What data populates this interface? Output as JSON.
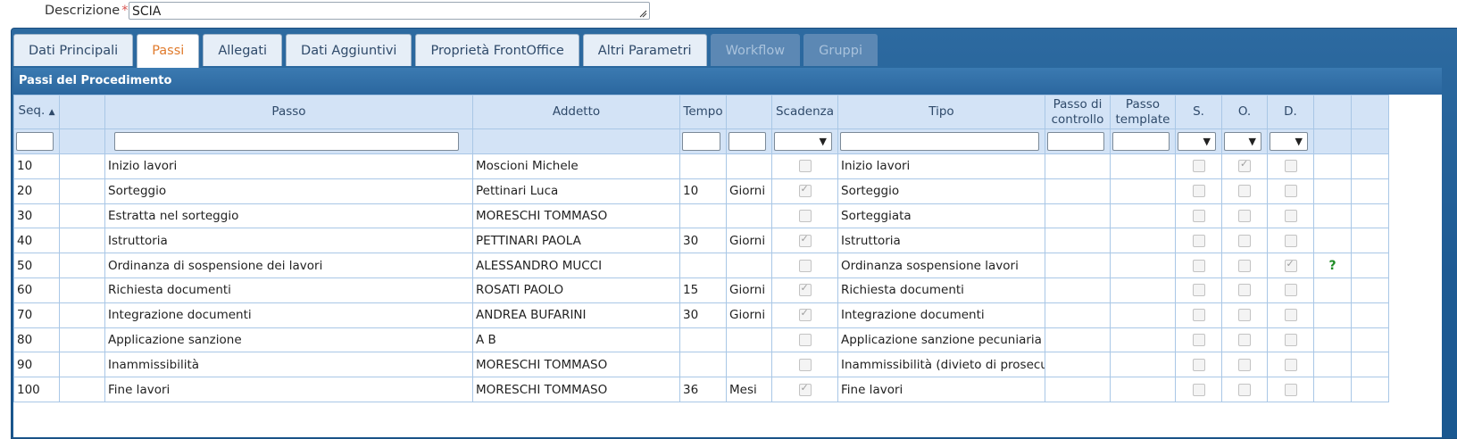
{
  "description": {
    "label": "Descrizione",
    "required_mark": "*",
    "value": "SCIA"
  },
  "tabs": [
    {
      "label": "Dati Principali",
      "state": "normal"
    },
    {
      "label": "Passi",
      "state": "active"
    },
    {
      "label": "Allegati",
      "state": "normal"
    },
    {
      "label": "Dati Aggiuntivi",
      "state": "normal"
    },
    {
      "label": "Proprietà FrontOffice",
      "state": "normal"
    },
    {
      "label": "Altri Parametri",
      "state": "normal"
    },
    {
      "label": "Workflow",
      "state": "disabled"
    },
    {
      "label": "Gruppi",
      "state": "disabled"
    }
  ],
  "section_title": "Passi del Procedimento",
  "columns": {
    "seq": "Seq.",
    "passo": "Passo",
    "addetto": "Addetto",
    "tempo": "Tempo",
    "scadenza": "Scadenza",
    "tipo": "Tipo",
    "passo_controllo_1": "Passo di",
    "passo_controllo_2": "controllo",
    "passo_template_1": "Passo",
    "passo_template_2": "template",
    "s": "S.",
    "o": "O.",
    "d": "D."
  },
  "rows": [
    {
      "seq": "10",
      "passo": "Inizio lavori",
      "addetto": "Moscioni Michele",
      "tempo": "",
      "unita": "",
      "scadenza": false,
      "tipo": "Inizio lavori",
      "s": false,
      "o": true,
      "d": false,
      "extra": ""
    },
    {
      "seq": "20",
      "passo": "Sorteggio",
      "addetto": "Pettinari Luca",
      "tempo": "10",
      "unita": "Giorni",
      "scadenza": true,
      "tipo": "Sorteggio",
      "s": false,
      "o": false,
      "d": false,
      "extra": ""
    },
    {
      "seq": "30",
      "passo": "Estratta nel sorteggio",
      "addetto": "MORESCHI TOMMASO",
      "tempo": "",
      "unita": "",
      "scadenza": false,
      "tipo": "Sorteggiata",
      "s": false,
      "o": false,
      "d": false,
      "extra": ""
    },
    {
      "seq": "40",
      "passo": "Istruttoria",
      "addetto": "PETTINARI PAOLA",
      "tempo": "30",
      "unita": "Giorni",
      "scadenza": true,
      "tipo": "Istruttoria",
      "s": false,
      "o": false,
      "d": false,
      "extra": ""
    },
    {
      "seq": "50",
      "passo": "Ordinanza di sospensione dei lavori",
      "addetto": "ALESSANDRO MUCCI",
      "tempo": "",
      "unita": "",
      "scadenza": false,
      "tipo": "Ordinanza sospensione lavori",
      "s": false,
      "o": false,
      "d": true,
      "extra": "?"
    },
    {
      "seq": "60",
      "passo": "Richiesta documenti",
      "addetto": "ROSATI PAOLO",
      "tempo": "15",
      "unita": "Giorni",
      "scadenza": true,
      "tipo": "Richiesta documenti",
      "s": false,
      "o": false,
      "d": false,
      "extra": ""
    },
    {
      "seq": "70",
      "passo": "Integrazione documenti",
      "addetto": "ANDREA BUFARINI",
      "tempo": "30",
      "unita": "Giorni",
      "scadenza": true,
      "tipo": "Integrazione documenti",
      "s": false,
      "o": false,
      "d": false,
      "extra": ""
    },
    {
      "seq": "80",
      "passo": "Applicazione sanzione",
      "addetto": "A B",
      "tempo": "",
      "unita": "",
      "scadenza": false,
      "tipo": "Applicazione sanzione pecuniaria (Art",
      "s": false,
      "o": false,
      "d": false,
      "extra": ""
    },
    {
      "seq": "90",
      "passo": "Inammissibilità",
      "addetto": "MORESCHI TOMMASO",
      "tempo": "",
      "unita": "",
      "scadenza": false,
      "tipo": "Inammissibilità (divieto di prosecuzio",
      "s": false,
      "o": false,
      "d": false,
      "extra": ""
    },
    {
      "seq": "100",
      "passo": "Fine lavori",
      "addetto": "MORESCHI TOMMASO",
      "tempo": "36",
      "unita": "Mesi",
      "scadenza": true,
      "tipo": "Fine lavori",
      "s": false,
      "o": false,
      "d": false,
      "extra": ""
    }
  ],
  "icons": {
    "sort": "sort-icon",
    "select_arrow": "chevron-down-icon",
    "resize": "resize-grip-icon"
  },
  "colors": {
    "active_tab_text": "#e07b2d",
    "panel_blue": "#1d5a93",
    "header_bg": "#d3e3f6",
    "help_green": "#1e8b24"
  }
}
